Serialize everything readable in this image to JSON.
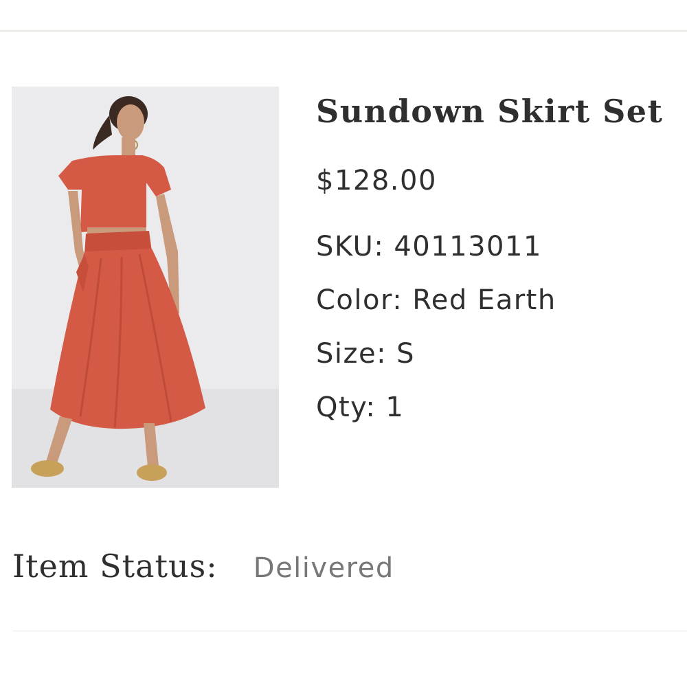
{
  "product": {
    "title": "Sundown Skirt Set",
    "price": "$128.00",
    "sku_label": "SKU:",
    "sku_value": "40113011",
    "color_label": "Color:",
    "color_value": "Red Earth",
    "size_label": "Size:",
    "size_value": "S",
    "qty_label": "Qty:",
    "qty_value": "1",
    "image_icon": "product-photo-woman-in-red-skirt-set"
  },
  "status": {
    "label": "Item Status:",
    "value": "Delivered"
  },
  "colors": {
    "garment": "#d45a45",
    "text": "#2f2f2f",
    "muted": "#777777",
    "divider": "#ece8e4",
    "photo_bg": "#e8e8ea"
  }
}
